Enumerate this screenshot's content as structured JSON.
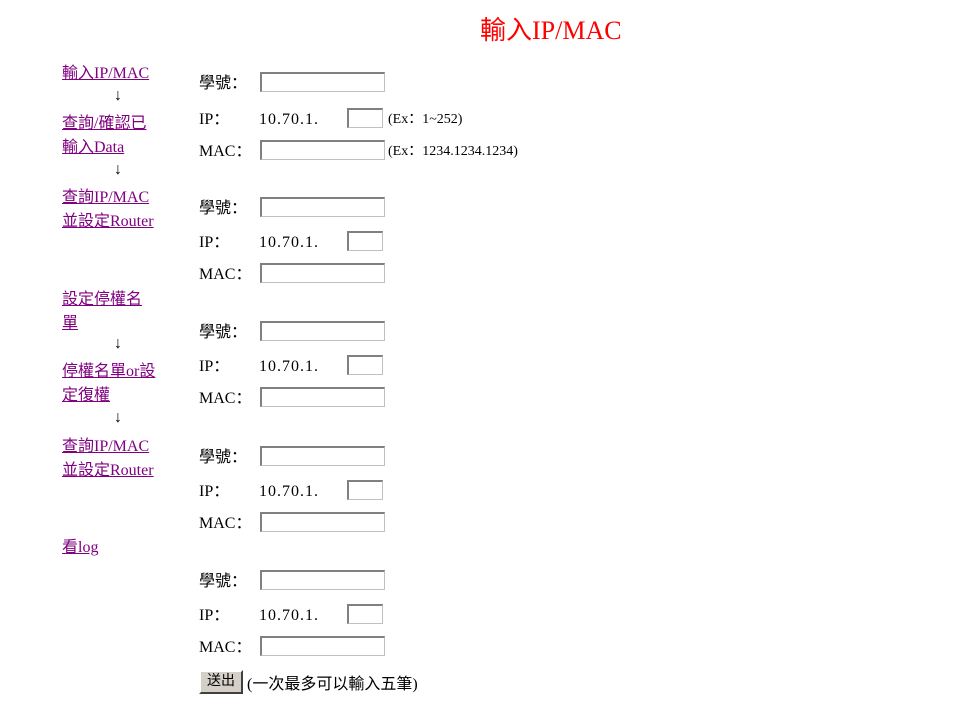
{
  "page_title": "輸入IP/MAC",
  "sidebar": {
    "items": [
      {
        "label_lines": [
          "輸入IP/MAC"
        ]
      },
      {
        "label_lines": [
          "查詢/確認已",
          "輸入Data"
        ]
      },
      {
        "label_lines": [
          "查詢IP/MAC",
          "並設定Router"
        ]
      },
      {
        "label_lines": [
          "設定停權名",
          "單"
        ]
      },
      {
        "label_lines": [
          "停權名單or設",
          "定復權"
        ]
      },
      {
        "label_lines": [
          "查詢IP/MAC",
          "並設定Router"
        ]
      },
      {
        "label_lines": [
          "看log"
        ]
      }
    ],
    "arrow": "↓"
  },
  "form": {
    "id_label": "學號：",
    "ip_label": "IP：",
    "mac_label": "MAC：",
    "ip_prefix": "10.70.1.",
    "ip_hint": "(Ex：1~252)",
    "mac_hint": "(Ex：1234.1234.1234)",
    "entries": [
      {
        "id_value": "",
        "ip_value": "",
        "mac_value": ""
      },
      {
        "id_value": "",
        "ip_value": "",
        "mac_value": ""
      },
      {
        "id_value": "",
        "ip_value": "",
        "mac_value": ""
      },
      {
        "id_value": "",
        "ip_value": "",
        "mac_value": ""
      },
      {
        "id_value": "",
        "ip_value": "",
        "mac_value": ""
      }
    ]
  },
  "submit": {
    "label": "送出",
    "note": "(一次最多可以輸入五筆)"
  }
}
